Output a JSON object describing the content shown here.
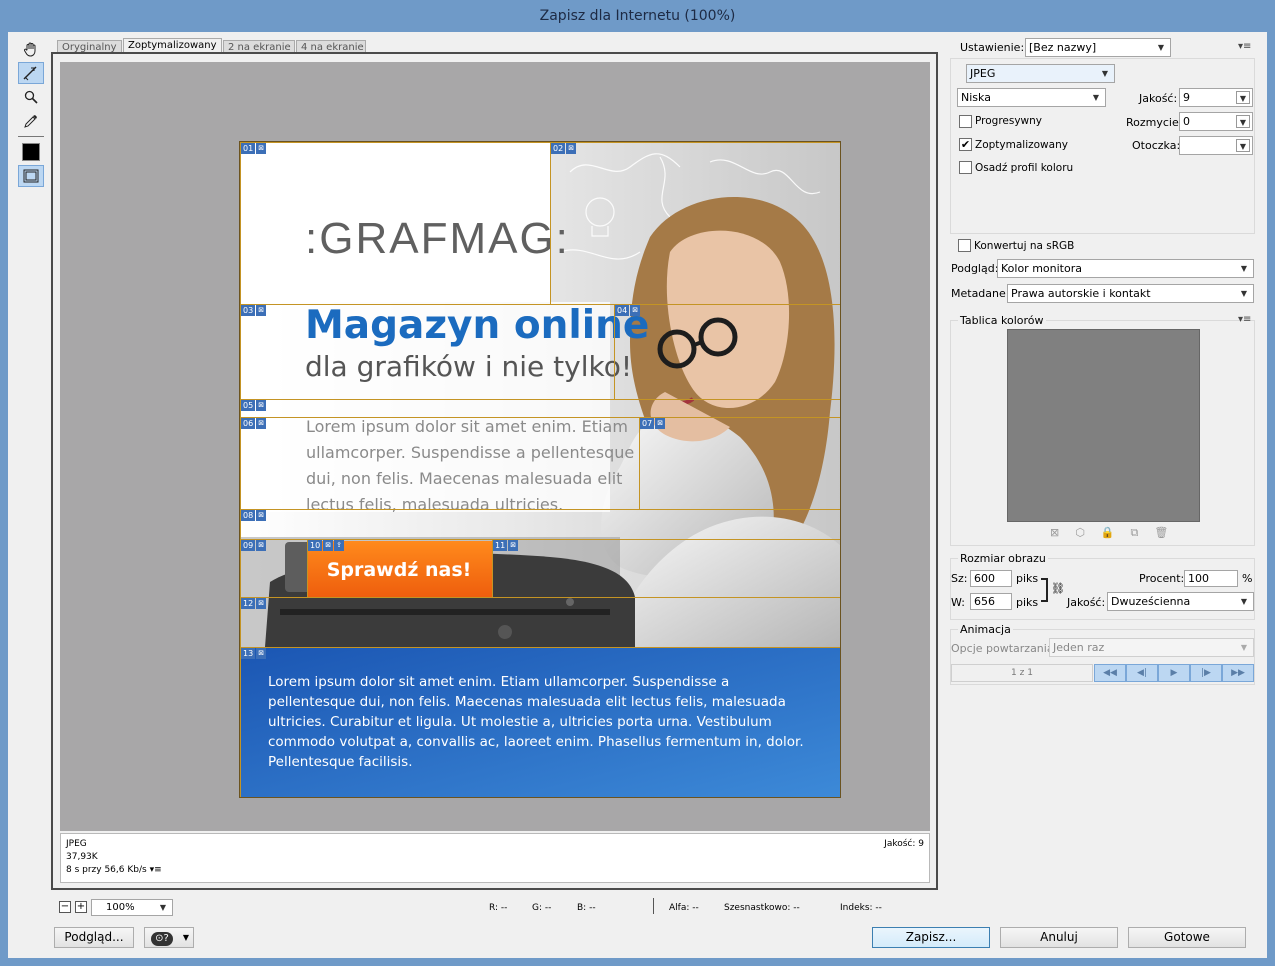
{
  "window": {
    "title": "Zapisz dla Internetu (100%)"
  },
  "tabs": [
    {
      "label": "Oryginalny"
    },
    {
      "label": "Zoptymalizowany"
    },
    {
      "label": "2 na ekranie"
    },
    {
      "label": "4 na ekranie"
    }
  ],
  "canvas": {
    "logo_text": ":GRAFMAG:",
    "headline": "Magazyn online",
    "subheadline": "dla grafików i nie tylko!",
    "lorem_gray": "Lorem ipsum dolor sit amet enim. Etiam ullamcorper. Suspendisse a pellentesque dui, non felis. Maecenas malesuada elit lectus felis, malesuada ultricies.",
    "cta": "Sprawdź nas!",
    "lorem_blue": "Lorem ipsum dolor sit amet enim. Etiam ullamcorper. Suspendisse a pellentesque dui, non felis. Maecenas malesuada elit lectus felis, malesuada ultricies. Curabitur et ligula. Ut molestie a, ultricies porta urna. Vestibulum commodo volutpat a, convallis ac, laoreet enim. Phasellus fermentum in, dolor. Pellentesque facilisis.",
    "slices": [
      {
        "n": "01"
      },
      {
        "n": "02"
      },
      {
        "n": "03"
      },
      {
        "n": "04"
      },
      {
        "n": "05"
      },
      {
        "n": "06"
      },
      {
        "n": "07"
      },
      {
        "n": "08"
      },
      {
        "n": "09"
      },
      {
        "n": "10"
      },
      {
        "n": "11"
      },
      {
        "n": "12"
      },
      {
        "n": "13"
      }
    ]
  },
  "infobar": {
    "format": "JPEG",
    "size": "37,93K",
    "speed": "8 s przy 56,6 Kb/s",
    "quality": "Jakość: 9"
  },
  "statusbar": {
    "zoom": "100%",
    "r": "R: --",
    "g": "G: --",
    "b": "B: --",
    "alpha": "Alfa: --",
    "hex": "Szesnastkowo: --",
    "index": "Indeks: --"
  },
  "buttons": {
    "preview": "Podgląd...",
    "save": "Zapisz...",
    "cancel": "Anuluj",
    "done": "Gotowe"
  },
  "settings": {
    "preset_label": "Ustawienie:",
    "preset_value": "[Bez nazwy]",
    "format_value": "JPEG",
    "quality_preset": "Niska",
    "quality_label": "Jakość:",
    "quality_value": "9",
    "progressive_label": "Progresywny",
    "progressive_checked": false,
    "blur_label": "Rozmycie:",
    "blur_value": "0",
    "optimized_label": "Zoptymalizowany",
    "optimized_checked": true,
    "matte_label": "Otoczka:",
    "matte_value": "",
    "embed_profile_label": "Osadź profil koloru",
    "embed_profile_checked": false,
    "srgb_label": "Konwertuj na sRGB",
    "srgb_checked": false,
    "preview_label": "Podgląd:",
    "preview_value": "Kolor monitora",
    "metadata_label": "Metadane:",
    "metadata_value": "Prawa autorskie i kontakt"
  },
  "color_table": {
    "title": "Tablica kolorów"
  },
  "image_size": {
    "title": "Rozmiar obrazu",
    "w_label": "Sz:",
    "w_value": "600",
    "w_unit": "piks",
    "h_label": "W:",
    "h_value": "656",
    "h_unit": "piks",
    "percent_label": "Procent:",
    "percent_value": "100",
    "percent_unit": "%",
    "quality_label": "Jakość:",
    "quality_value": "Dwuześcienna"
  },
  "animation": {
    "title": "Animacja",
    "loop_label": "Opcje powtarzania:",
    "loop_value": "Jeden raz",
    "frame": "1 z 1"
  },
  "colors": {
    "accent": "#3c6fb7",
    "cta_orange": "#f06a10",
    "headline_blue": "#1b6bbf",
    "slice_line": "#c49424"
  }
}
